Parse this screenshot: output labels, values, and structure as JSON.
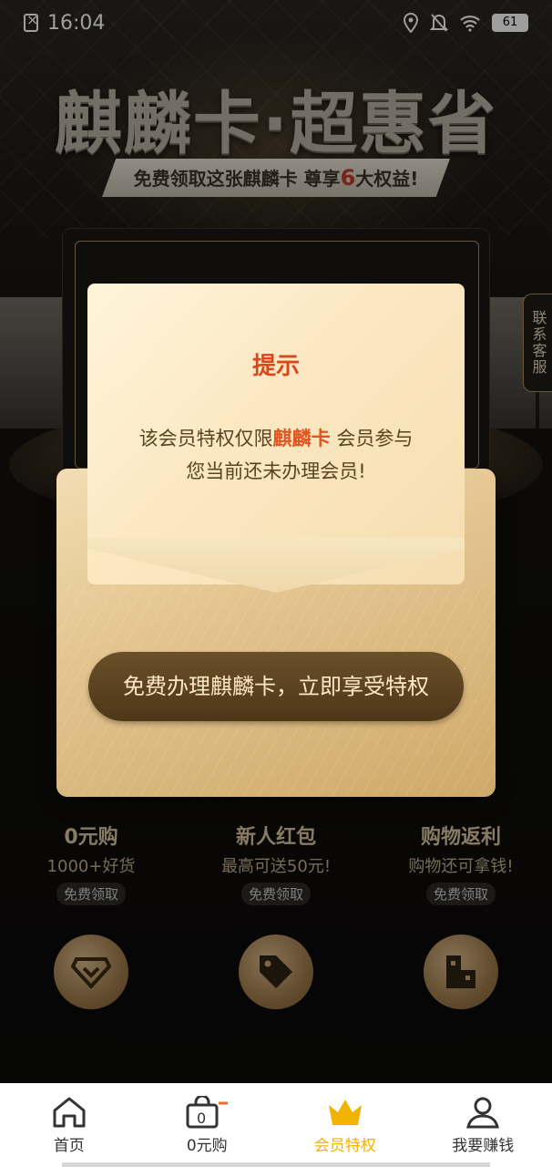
{
  "status_bar": {
    "time": "16:04",
    "battery": "61"
  },
  "hero": {
    "headline": "麒麟卡·超惠省",
    "subtitle_prefix": "免费领取这张麒麟卡  尊享",
    "subtitle_number": "6",
    "subtitle_suffix": "大权益!"
  },
  "side_tab": {
    "label": "联系客服"
  },
  "benefits": [
    {
      "title": "0元购",
      "desc": "1000+好货",
      "tag": "免费领取"
    },
    {
      "title": "新人红包",
      "desc": "最高可送50元!",
      "tag": "免费领取"
    },
    {
      "title": "购物返利",
      "desc": "购物还可拿钱!",
      "tag": "免费领取"
    }
  ],
  "modal": {
    "title": "提示",
    "line1_prefix": "该会员特权仅限",
    "line1_highlight": "麒麟卡",
    "line1_suffix": " 会员参与",
    "line2": "您当前还未办理会员!",
    "cta": "免费办理麒麟卡，立即享受特权"
  },
  "bottom_nav": {
    "items": [
      {
        "label": "首页",
        "icon": "home-icon"
      },
      {
        "label": "0元购",
        "icon": "shopping-bag-icon"
      },
      {
        "label": "会员特权",
        "icon": "crown-icon",
        "active": true
      },
      {
        "label": "我要赚钱",
        "icon": "user-icon"
      }
    ]
  },
  "colors": {
    "accent": "#f0b400",
    "highlight": "#e05522",
    "gold": "#a88c5c"
  }
}
